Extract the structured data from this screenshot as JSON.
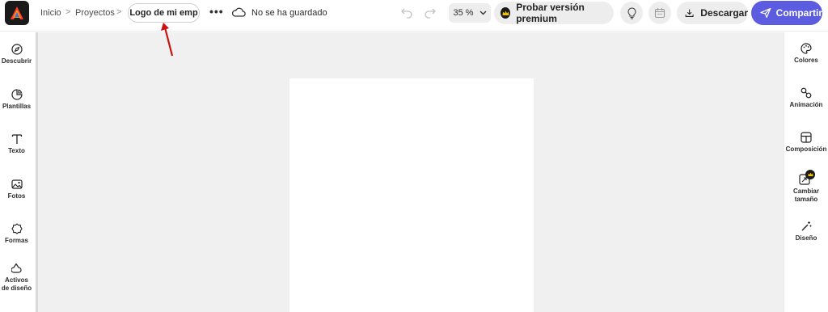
{
  "header": {
    "breadcrumbs": [
      "Inicio",
      "Proyectos"
    ],
    "breadcrumb_separator": ">",
    "document_name": "Logo de mi emp",
    "more_label": "•••",
    "save_status": "No se ha guardado",
    "zoom_value": "35 %",
    "premium_label": "Probar versión premium",
    "download_label": "Descargar",
    "share_label": "Compartir"
  },
  "left_sidebar": {
    "items": [
      {
        "label": "Descubrir",
        "icon": "compass-icon"
      },
      {
        "label": "Plantillas",
        "icon": "templates-icon"
      },
      {
        "label": "Texto",
        "icon": "text-icon"
      },
      {
        "label": "Fotos",
        "icon": "photo-icon"
      },
      {
        "label": "Formas",
        "icon": "shapes-icon"
      },
      {
        "label": "Activos de diseño",
        "icon": "design-assets-icon"
      }
    ]
  },
  "right_sidebar": {
    "items": [
      {
        "label": "Colores",
        "icon": "palette-icon"
      },
      {
        "label": "Animación",
        "icon": "animation-icon"
      },
      {
        "label": "Composición",
        "icon": "layout-icon"
      },
      {
        "label": "Cambiar tamaño",
        "icon": "resize-icon"
      },
      {
        "label": "Diseño",
        "icon": "magic-wand-icon"
      }
    ]
  },
  "colors": {
    "accent": "#5c5ce0",
    "canvas_bg": "#f0f0f0",
    "annotation_arrow": "#cc1111"
  }
}
